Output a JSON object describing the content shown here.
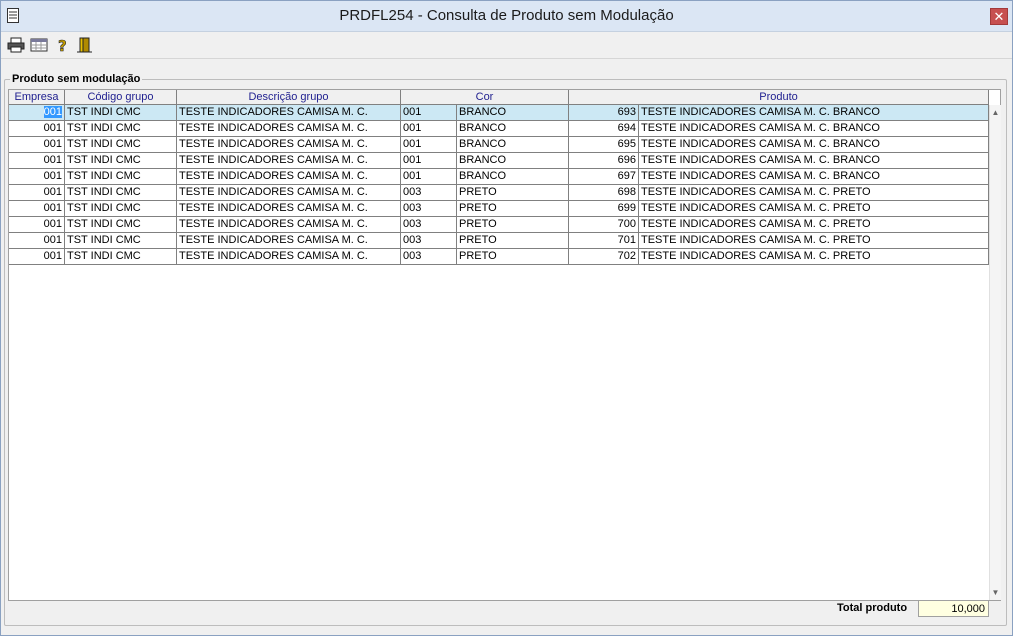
{
  "window": {
    "title": "PRDFL254 - Consulta de Produto sem Modulação",
    "close_label": "✕"
  },
  "group": {
    "label": "Produto sem modulação"
  },
  "grid": {
    "headers": [
      "Empresa",
      "Código grupo",
      "Descrição grupo",
      "Cor",
      "Produto"
    ],
    "rows": [
      [
        "001",
        "TST INDI CMC",
        "TESTE INDICADORES CAMISA M. C.",
        "001",
        "BRANCO",
        "693",
        "TESTE INDICADORES CAMISA M. C. BRANCO"
      ],
      [
        "001",
        "TST INDI CMC",
        "TESTE INDICADORES CAMISA M. C.",
        "001",
        "BRANCO",
        "694",
        "TESTE INDICADORES CAMISA M. C. BRANCO"
      ],
      [
        "001",
        "TST INDI CMC",
        "TESTE INDICADORES CAMISA M. C.",
        "001",
        "BRANCO",
        "695",
        "TESTE INDICADORES CAMISA M. C. BRANCO"
      ],
      [
        "001",
        "TST INDI CMC",
        "TESTE INDICADORES CAMISA M. C.",
        "001",
        "BRANCO",
        "696",
        "TESTE INDICADORES CAMISA M. C. BRANCO"
      ],
      [
        "001",
        "TST INDI CMC",
        "TESTE INDICADORES CAMISA M. C.",
        "001",
        "BRANCO",
        "697",
        "TESTE INDICADORES CAMISA M. C. BRANCO"
      ],
      [
        "001",
        "TST INDI CMC",
        "TESTE INDICADORES CAMISA M. C.",
        "003",
        "PRETO",
        "698",
        "TESTE INDICADORES CAMISA M. C. PRETO"
      ],
      [
        "001",
        "TST INDI CMC",
        "TESTE INDICADORES CAMISA M. C.",
        "003",
        "PRETO",
        "699",
        "TESTE INDICADORES CAMISA M. C. PRETO"
      ],
      [
        "001",
        "TST INDI CMC",
        "TESTE INDICADORES CAMISA M. C.",
        "003",
        "PRETO",
        "700",
        "TESTE INDICADORES CAMISA M. C. PRETO"
      ],
      [
        "001",
        "TST INDI CMC",
        "TESTE INDICADORES CAMISA M. C.",
        "003",
        "PRETO",
        "701",
        "TESTE INDICADORES CAMISA M. C. PRETO"
      ],
      [
        "001",
        "TST INDI CMC",
        "TESTE INDICADORES CAMISA M. C.",
        "003",
        "PRETO",
        "702",
        "TESTE INDICADORES CAMISA M. C. PRETO"
      ]
    ]
  },
  "footer": {
    "total_label": "Total produto",
    "total_value": "10,000"
  },
  "toolbar": {
    "icons": [
      "printer-icon",
      "grid-view-icon",
      "help-icon",
      "exit-door-icon"
    ]
  },
  "colors": {
    "selected_row": "#cce8f4",
    "header_text": "#1f1f8f",
    "total_bg": "#ffffe1"
  }
}
